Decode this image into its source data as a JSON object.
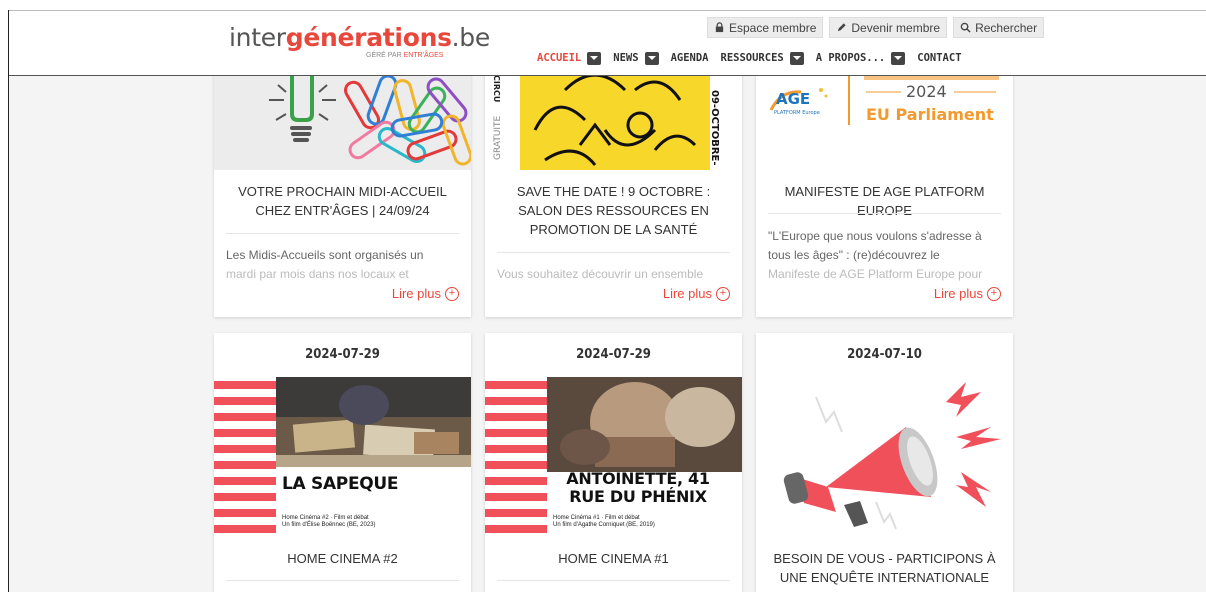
{
  "header": {
    "logo": {
      "part1": "inter",
      "part2": "générations",
      "part3": ".be",
      "sub_prefix": "GÉRÉ PAR ",
      "sub_brand": "ENTR'ÂGES"
    },
    "top_links": [
      {
        "label": "Espace membre",
        "icon": "lock-icon"
      },
      {
        "label": "Devenir membre",
        "icon": "pencil-icon"
      },
      {
        "label": "Rechercher",
        "icon": "search-icon"
      }
    ],
    "nav": [
      {
        "label": "ACCUEIL",
        "dropdown": true,
        "active": true
      },
      {
        "label": "NEWS",
        "dropdown": true
      },
      {
        "label": "AGENDA",
        "dropdown": false
      },
      {
        "label": "RESSOURCES",
        "dropdown": true
      },
      {
        "label": "A PROPOS...",
        "dropdown": true
      },
      {
        "label": "CONTACT",
        "dropdown": false
      }
    ]
  },
  "cards_top": [
    {
      "title": "VOTRE PROCHAIN MIDI-ACCUEIL CHEZ ENTR'ÂGES | 24/09/24",
      "excerpt": "Les Midis-Accueils sont organisés un",
      "excerpt_faded": "mardi par mois dans nos locaux et",
      "read_more": "Lire plus"
    },
    {
      "title": "SAVE THE DATE ! 9 OCTOBRE : SALON DES RESSOURCES EN PROMOTION DE LA SANTÉ",
      "excerpt": "",
      "excerpt_faded": "Vous souhaitez découvrir un ensemble",
      "read_more": "Lire plus",
      "image_text_vertical": "09-OCTOBRE-",
      "image_text_side": "GRATUITE",
      "image_text_top": "CIRCU"
    },
    {
      "title": "MANIFESTE DE AGE PLATFORM EUROPE",
      "excerpt": "\"L'Europe que nous voulons s'adresse à tous les âges\" : (re)découvrez le",
      "excerpt_faded": "Manifeste de AGE Platform Europe pour",
      "read_more": "Lire plus",
      "image_logo": "AGE",
      "image_logo_sub": "PLATFORM Europe",
      "image_year": "2024",
      "image_caption": "EU Parliament"
    }
  ],
  "cards_bottom": [
    {
      "date": "2024-07-29",
      "title": "HOME CINEMA #2",
      "film_title": "LA SAPEQUE",
      "film_line1": "Home Cinéma #2 · Film et débat",
      "film_line2": "Un film d'Élise Boënnec (BE, 2023)"
    },
    {
      "date": "2024-07-29",
      "title": "HOME CINEMA #1",
      "film_title": "ANTOINETTE, 41 RUE DU PHÉNIX",
      "film_line1": "Home Cinéma #1 · Film et débat",
      "film_line2": "Un film d'Agathe Corniquet (BE, 2019)"
    },
    {
      "date": "2024-07-10",
      "title": "BESOIN DE VOUS - PARTICIPONS À UNE ENQUÊTE INTERNATIONALE"
    }
  ],
  "colors": {
    "accent": "#e8483c",
    "stripe": "#f0505a"
  }
}
